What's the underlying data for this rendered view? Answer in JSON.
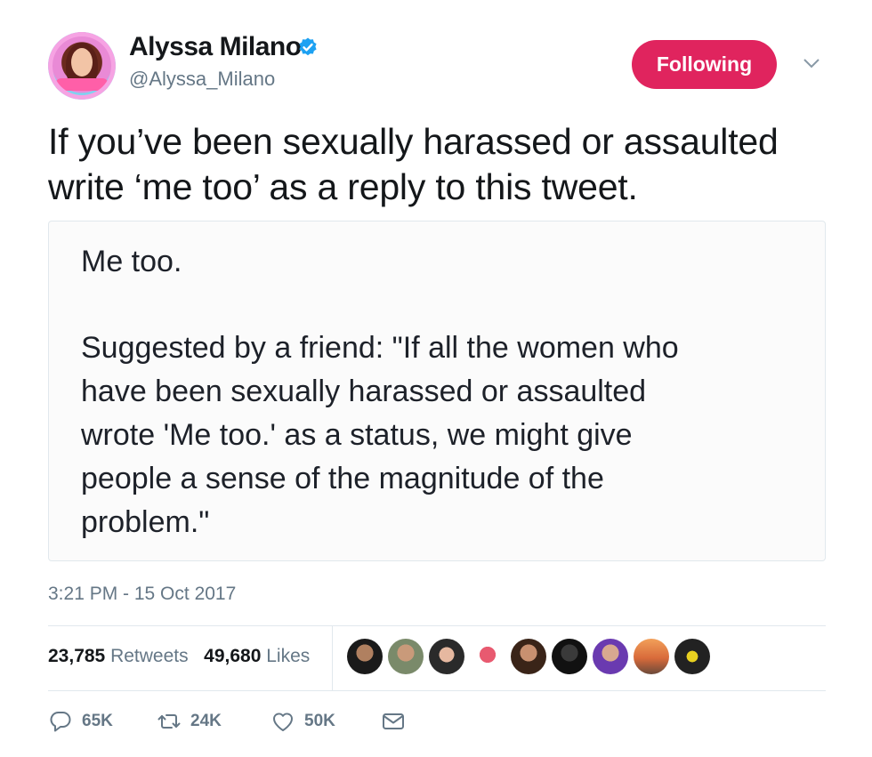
{
  "user": {
    "name": "Alyssa Milano",
    "handle": "@Alyssa_Milano",
    "verified": true,
    "follow_label": "Following"
  },
  "tweet": {
    "text_line1": "If you’ve been sexually harassed or assaulted",
    "text_line2": "write ‘me too’ as a reply to this tweet.",
    "timestamp": "3:21 PM - 15 Oct 2017"
  },
  "media": {
    "line1": "Me too.",
    "body_lines": [
      "Suggested by a friend: \"If all the women who",
      "have been sexually harassed or assaulted",
      "wrote 'Me too.' as a status, we might give",
      "people a sense of the magnitude of the",
      "problem.\""
    ]
  },
  "stats": {
    "retweets_count": "23,785",
    "retweets_label": "Retweets",
    "likes_count": "49,680",
    "likes_label": "Likes"
  },
  "actions": {
    "reply_count": "65K",
    "retweet_count": "24K",
    "like_count": "50K"
  },
  "icons": {
    "verified": "verified-badge-icon",
    "caret": "chevron-down-icon",
    "reply": "reply-icon",
    "retweet": "retweet-icon",
    "like": "heart-icon",
    "dm": "envelope-icon"
  },
  "colors": {
    "follow_button": "#e0245e",
    "verified": "#1da1f2",
    "muted": "#657786",
    "border": "#e1e8ed"
  }
}
